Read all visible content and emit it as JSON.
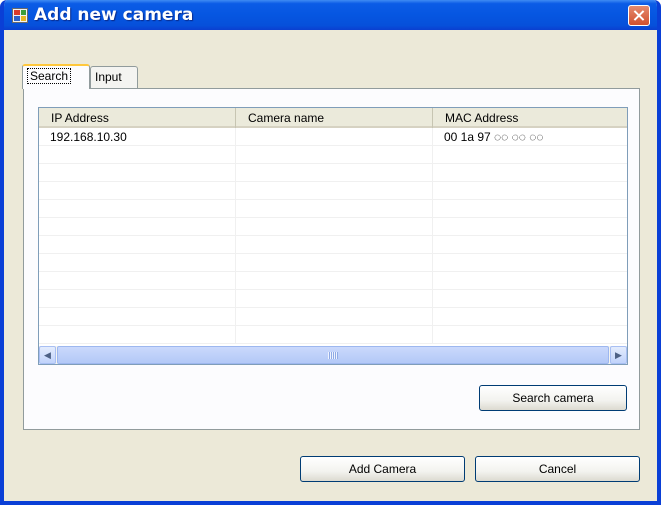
{
  "window": {
    "title": "Add new camera",
    "accent": "#0a3fd6",
    "background": "#ece9d8"
  },
  "tabs": [
    {
      "label": "Search",
      "active": true
    },
    {
      "label": "Input",
      "active": false
    }
  ],
  "grid": {
    "columns": [
      "IP Address",
      "Camera name",
      "MAC Address"
    ],
    "rows": [
      [
        "192.168.10.30",
        "",
        "00 1a 97 ◌◌ ◌◌ ◌◌"
      ]
    ],
    "visible_row_count": 12
  },
  "buttons": {
    "search_camera": "Search camera",
    "add_camera": "Add Camera",
    "cancel": "Cancel"
  },
  "icons": {
    "app": "window-app-icon",
    "close": "close-icon",
    "scroll_left": "chevron-left-icon",
    "scroll_right": "chevron-right-icon"
  }
}
